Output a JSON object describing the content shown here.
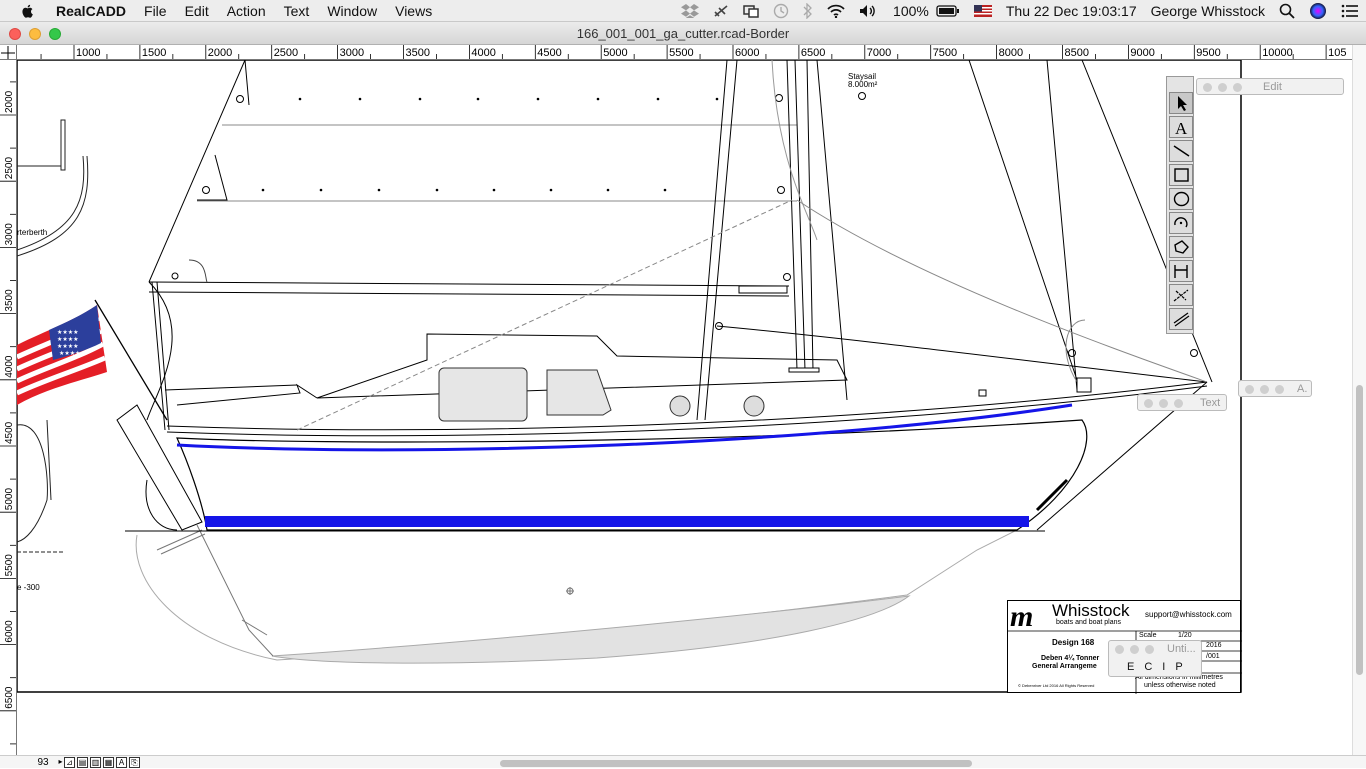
{
  "menubar": {
    "app_name": "RealCADD",
    "items": [
      "File",
      "Edit",
      "Action",
      "Text",
      "Window",
      "Views"
    ],
    "battery": "100%",
    "datetime": "Thu 22 Dec  19:03:17",
    "user": "George Whisstock"
  },
  "window": {
    "title": "166_001_001_ga_cutter.rcad-Border"
  },
  "ruler": {
    "h_labels": [
      "1000",
      "1500",
      "2000",
      "2500",
      "3000",
      "3500",
      "4000",
      "4500",
      "5000",
      "5500",
      "6000",
      "6500",
      "7000",
      "7500",
      "8000",
      "8500",
      "9000",
      "9500",
      "10000",
      "105"
    ],
    "v_labels": [
      "2000",
      "2500",
      "3000",
      "3500",
      "4000",
      "4500",
      "5000",
      "5500",
      "6000",
      "6500"
    ]
  },
  "drawing": {
    "staysail_label": "Staysail",
    "staysail_area": "8.000m²",
    "quarterberth_label": "rterberth",
    "depth_label": "e -300"
  },
  "title_block": {
    "brand": "Whisstock",
    "tagline": "boats and boat plans",
    "email": "support@whisstock.com",
    "design": "Design 168",
    "scale_label": "Scale",
    "scale_value": "1/20",
    "date_partial": "2016",
    "sheet_partial": "/001",
    "boat_name": "Deben 4¼ Tonner",
    "drawing_type": "General Arrangeme",
    "units_line1": "All dimensions in millimetres",
    "units_line2": "unless otherwise noted",
    "copyright": "© Debenriver Ltd 2016  All Rights Reserved"
  },
  "palettes": {
    "edit_title": "Edit",
    "text_title": "Text",
    "a_title": "A.",
    "unti_title": "Unti...",
    "unti_buttons": [
      "E",
      "C",
      "I",
      "P"
    ]
  },
  "bottom": {
    "page_number": "93"
  }
}
